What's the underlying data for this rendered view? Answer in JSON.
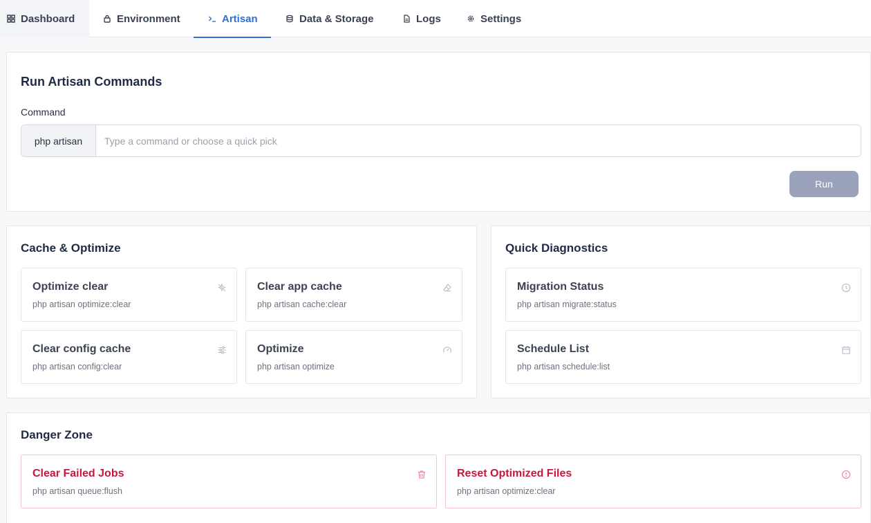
{
  "nav": {
    "tabs": [
      {
        "label": "Dashboard",
        "icon": "grid-icon"
      },
      {
        "label": "Environment",
        "icon": "lock-icon"
      },
      {
        "label": "Artisan",
        "icon": "terminal-icon",
        "active": true
      },
      {
        "label": "Data & Storage",
        "icon": "database-icon"
      },
      {
        "label": "Logs",
        "icon": "file-icon"
      },
      {
        "label": "Settings",
        "icon": "gear-icon"
      }
    ]
  },
  "run": {
    "title": "Run Artisan Commands",
    "command_label": "Command",
    "prefix": "php artisan",
    "input_value": "",
    "placeholder": "Type a command or choose a quick pick",
    "run_label": "Run"
  },
  "cache": {
    "title": "Cache & Optimize",
    "tiles": [
      {
        "title": "Optimize clear",
        "command": "php artisan optimize:clear",
        "icon": "sparkle-off-icon"
      },
      {
        "title": "Clear app cache",
        "command": "php artisan cache:clear",
        "icon": "eraser-icon"
      },
      {
        "title": "Clear config cache",
        "command": "php artisan config:clear",
        "icon": "sliders-icon"
      },
      {
        "title": "Optimize",
        "command": "php artisan optimize",
        "icon": "gauge-icon"
      }
    ]
  },
  "diagnostics": {
    "title": "Quick Diagnostics",
    "tiles": [
      {
        "title": "Migration Status",
        "command": "php artisan migrate:status",
        "icon": "clock-icon"
      },
      {
        "title": "Schedule List",
        "command": "php artisan schedule:list",
        "icon": "calendar-icon"
      }
    ]
  },
  "danger": {
    "title": "Danger Zone",
    "tiles": [
      {
        "title": "Clear Failed Jobs",
        "command": "php artisan queue:flush",
        "icon": "trash-icon"
      },
      {
        "title": "Reset Optimized Files",
        "command": "php artisan optimize:clear",
        "icon": "alert-circle-icon"
      }
    ]
  },
  "colors": {
    "accent": "#2f6fd6",
    "danger": "#c4183c",
    "run_button": "#9aa3bb"
  }
}
